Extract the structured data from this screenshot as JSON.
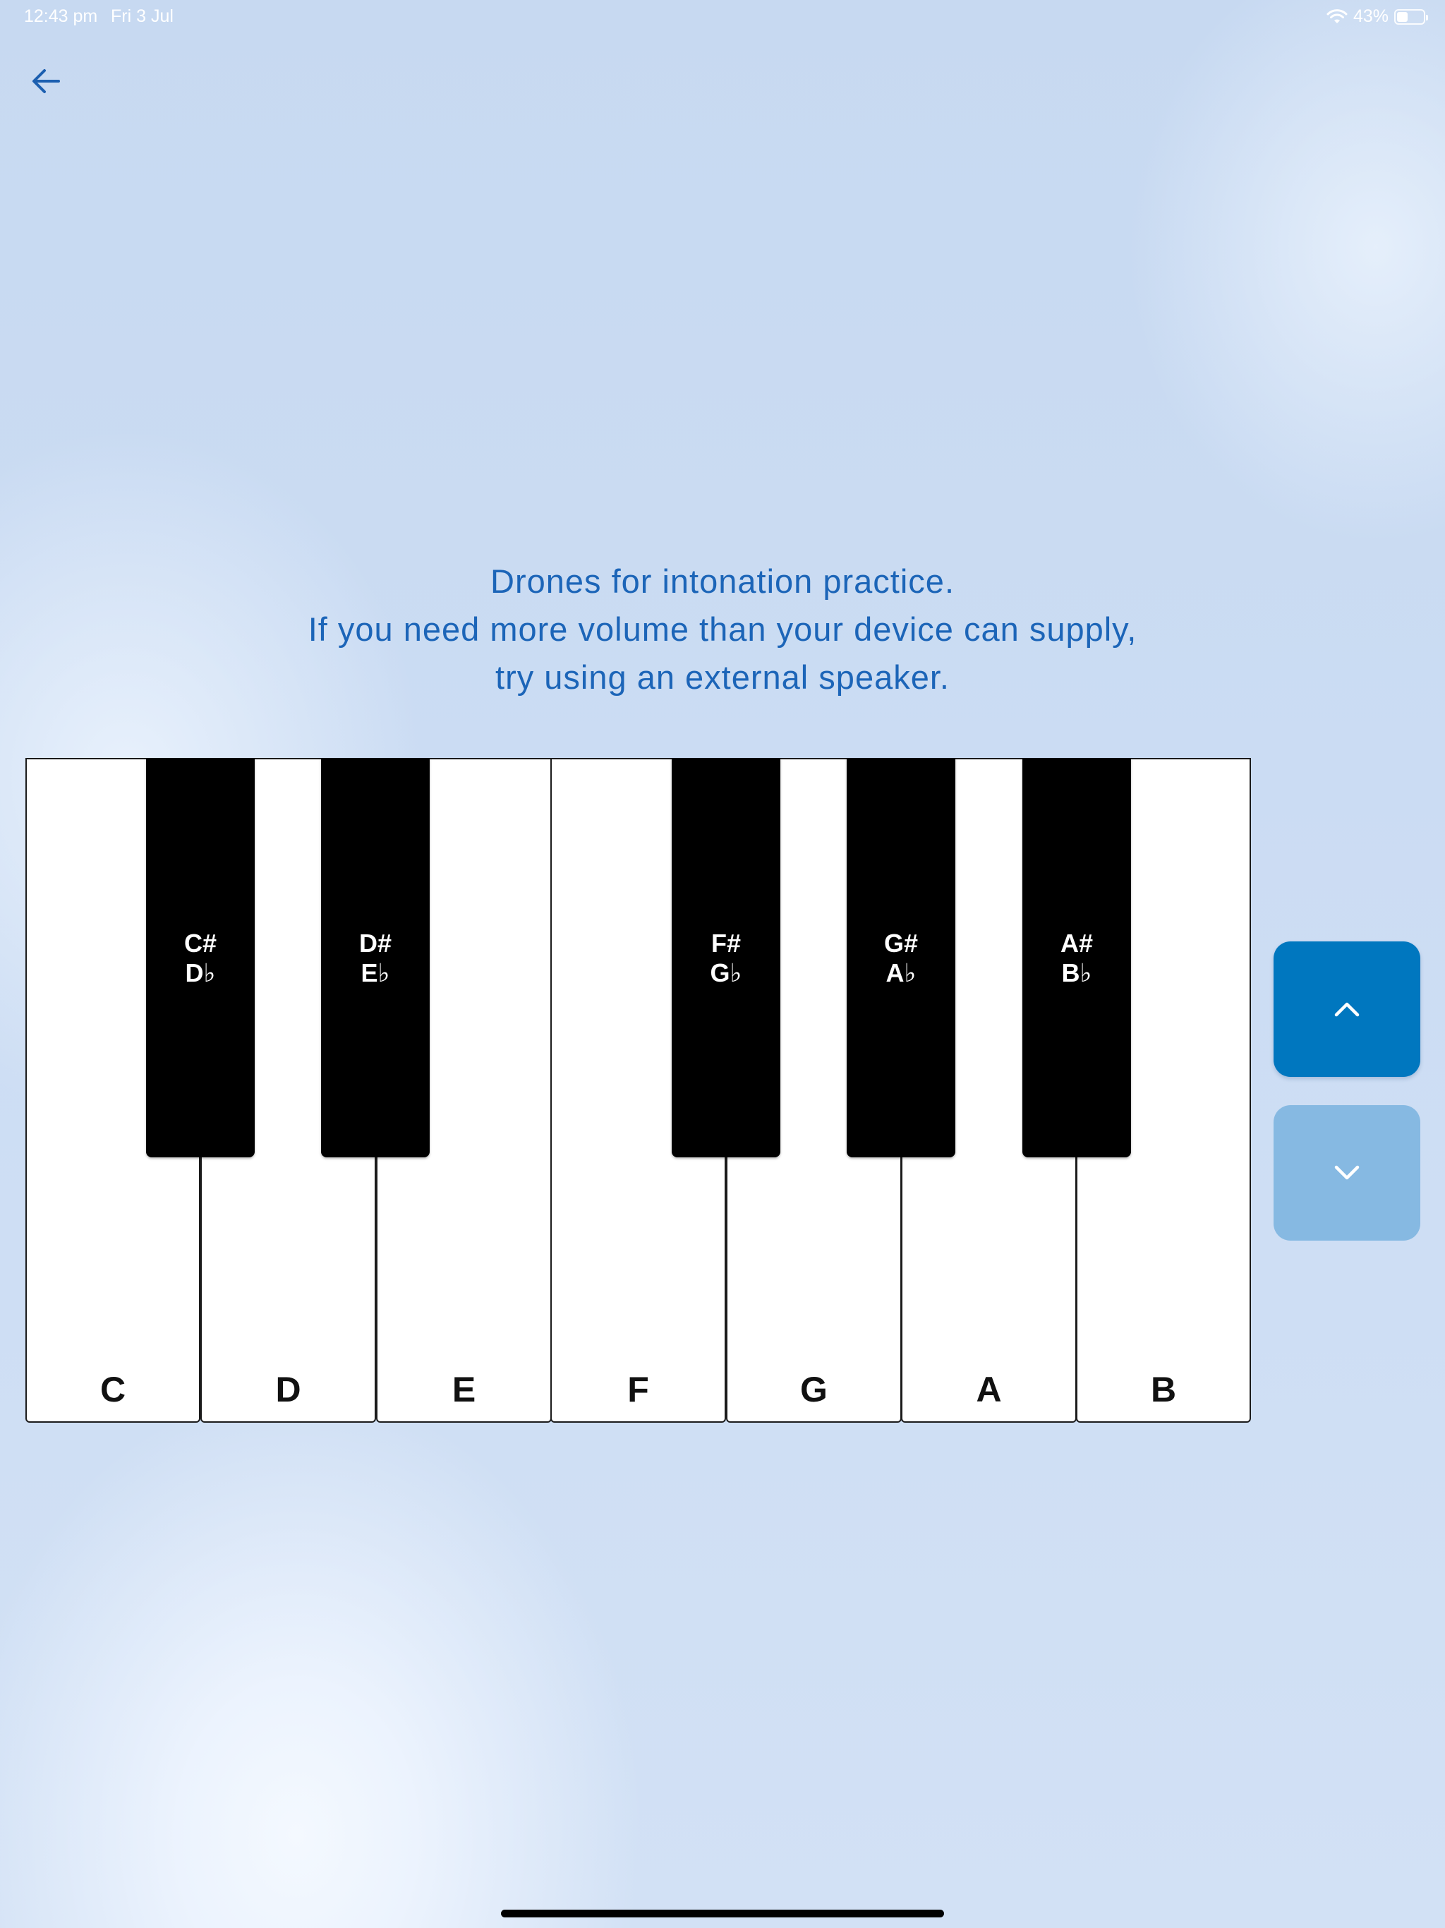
{
  "status_bar": {
    "time": "12:43 pm",
    "date": "Fri 3 Jul",
    "battery_percent": "43%",
    "battery_level": 0.43,
    "wifi_icon": "wifi-icon",
    "battery_icon": "battery-icon"
  },
  "nav": {
    "back_icon": "arrow-left-icon"
  },
  "intro": {
    "line1": "Drones for intonation practice.",
    "line2": "If you need more volume than your device can supply,",
    "line3": "try using an external speaker."
  },
  "keyboard": {
    "white_keys": [
      "C",
      "D",
      "E",
      "F",
      "G",
      "A",
      "B"
    ],
    "black_keys": [
      {
        "sharp": "C#",
        "flat": "D♭"
      },
      {
        "sharp": "D#",
        "flat": "E♭"
      },
      {
        "sharp": "F#",
        "flat": "G♭"
      },
      {
        "sharp": "G#",
        "flat": "A♭"
      },
      {
        "sharp": "A#",
        "flat": "B♭"
      }
    ]
  },
  "octave_controls": {
    "up_icon": "chevron-up-icon",
    "down_icon": "chevron-down-icon"
  },
  "colors": {
    "accent_text": "#1c65b8",
    "octave_up": "#0077bf",
    "octave_down": "#86b9e2"
  }
}
